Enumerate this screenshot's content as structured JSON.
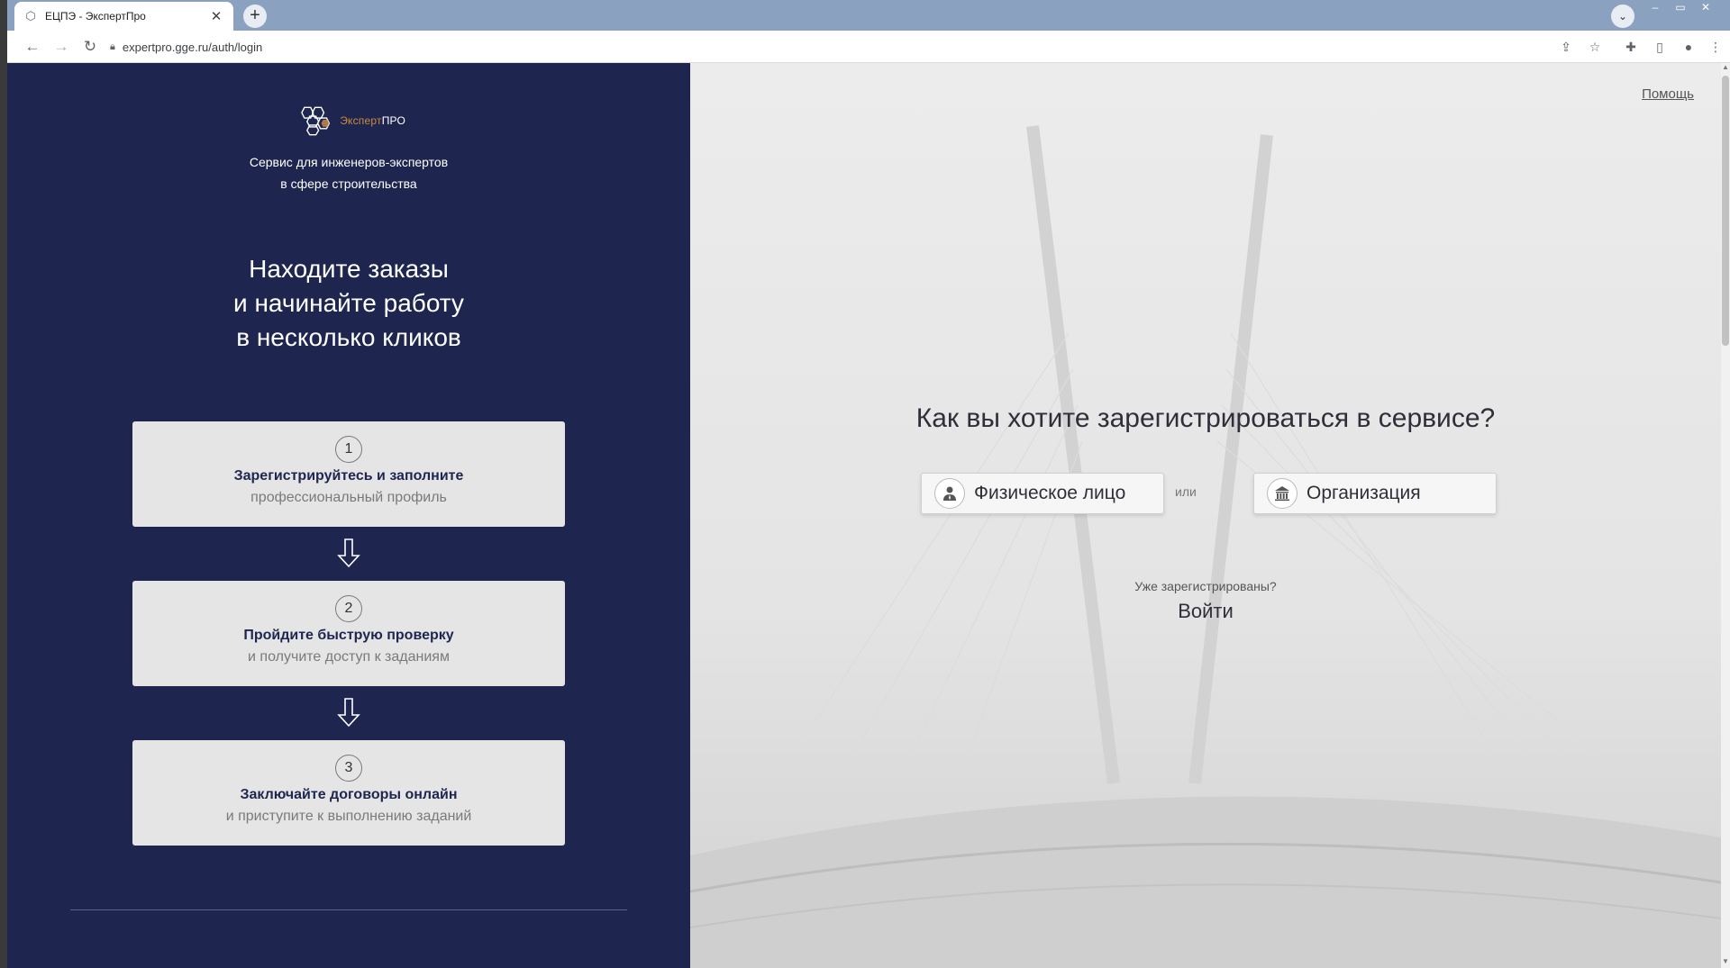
{
  "browser": {
    "tab_title": "ЕЦПЭ - ЭкспертПро",
    "tab_close": "✕",
    "new_tab": "+",
    "url": "expertpro.gge.ru/auth/login"
  },
  "left": {
    "logo": {
      "brand_main": "Эксперт",
      "brand_accent": "ПРО"
    },
    "tagline": [
      "Сервис для инженеров-экспертов",
      "в сфере строительства"
    ],
    "headline": [
      "Находите заказы",
      "и начинайте работу",
      "в несколько кликов"
    ],
    "steps": [
      {
        "num": "1",
        "title": "Зарегистрируйтесь и заполните",
        "subtitle": "профессиональный профиль"
      },
      {
        "num": "2",
        "title": "Пройдите быструю проверку",
        "subtitle": "и получите доступ к заданиям"
      },
      {
        "num": "3",
        "title": "Заключайте договоры онлайн",
        "subtitle": "и приступите к выполнению заданий"
      }
    ]
  },
  "right": {
    "help": "Помощь",
    "question": "Как вы хотите зарегистрироваться в сервисе?",
    "individual_label": "Физическое лицо",
    "or": "или",
    "organization_label": "Организация",
    "already_registered": "Уже зарегистрированы?",
    "login": "Войти"
  },
  "colors": {
    "left_panel": "#1e2650",
    "card": "#e5e5e5",
    "accent": "#c98a3f"
  }
}
